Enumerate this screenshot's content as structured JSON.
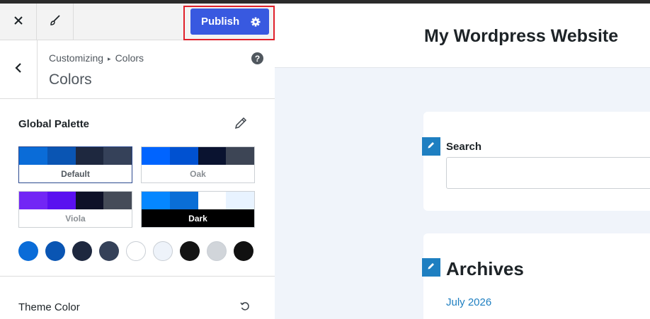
{
  "toolbar": {
    "close_icon": "close-icon",
    "brush_icon": "brush-icon",
    "publish_label": "Publish",
    "settings_icon": "gear-icon"
  },
  "section": {
    "breadcrumb_parent": "Customizing",
    "breadcrumb_separator": "▸",
    "breadcrumb_current": "Colors",
    "title": "Colors",
    "help_label": "?"
  },
  "global_palette": {
    "label": "Global Palette",
    "presets": [
      {
        "name": "Default",
        "selected": true,
        "colors": [
          "#0a6cd8",
          "#0a55b3",
          "#1e283f",
          "#354159"
        ]
      },
      {
        "name": "Oak",
        "selected": false,
        "colors": [
          "#0064ff",
          "#0051d1",
          "#0a1330",
          "#3d4555"
        ]
      },
      {
        "name": "Viola",
        "selected": false,
        "colors": [
          "#7226f5",
          "#5a10f0",
          "#0e1128",
          "#454b58"
        ]
      },
      {
        "name": "Dark",
        "selected": false,
        "colors": [
          "#0587ff",
          "#0a6ed6",
          "#ffffff",
          "#e8f3ff"
        ]
      }
    ],
    "swatches": [
      "#0a6cd8",
      "#0a55b3",
      "#1e283f",
      "#354159",
      "#ffffff",
      "#eef3fa",
      "#141414",
      "#d1d5da",
      "#111111"
    ]
  },
  "theme_color": {
    "label": "Theme Color"
  },
  "preview": {
    "site_title": "My Wordpress Website",
    "search_label": "Search",
    "archives_heading": "Archives",
    "archive_link": "July 2026"
  },
  "colors": {
    "publish_bg": "#3859e0",
    "highlight_outline": "#e0202a",
    "link": "#1e7fc1"
  }
}
